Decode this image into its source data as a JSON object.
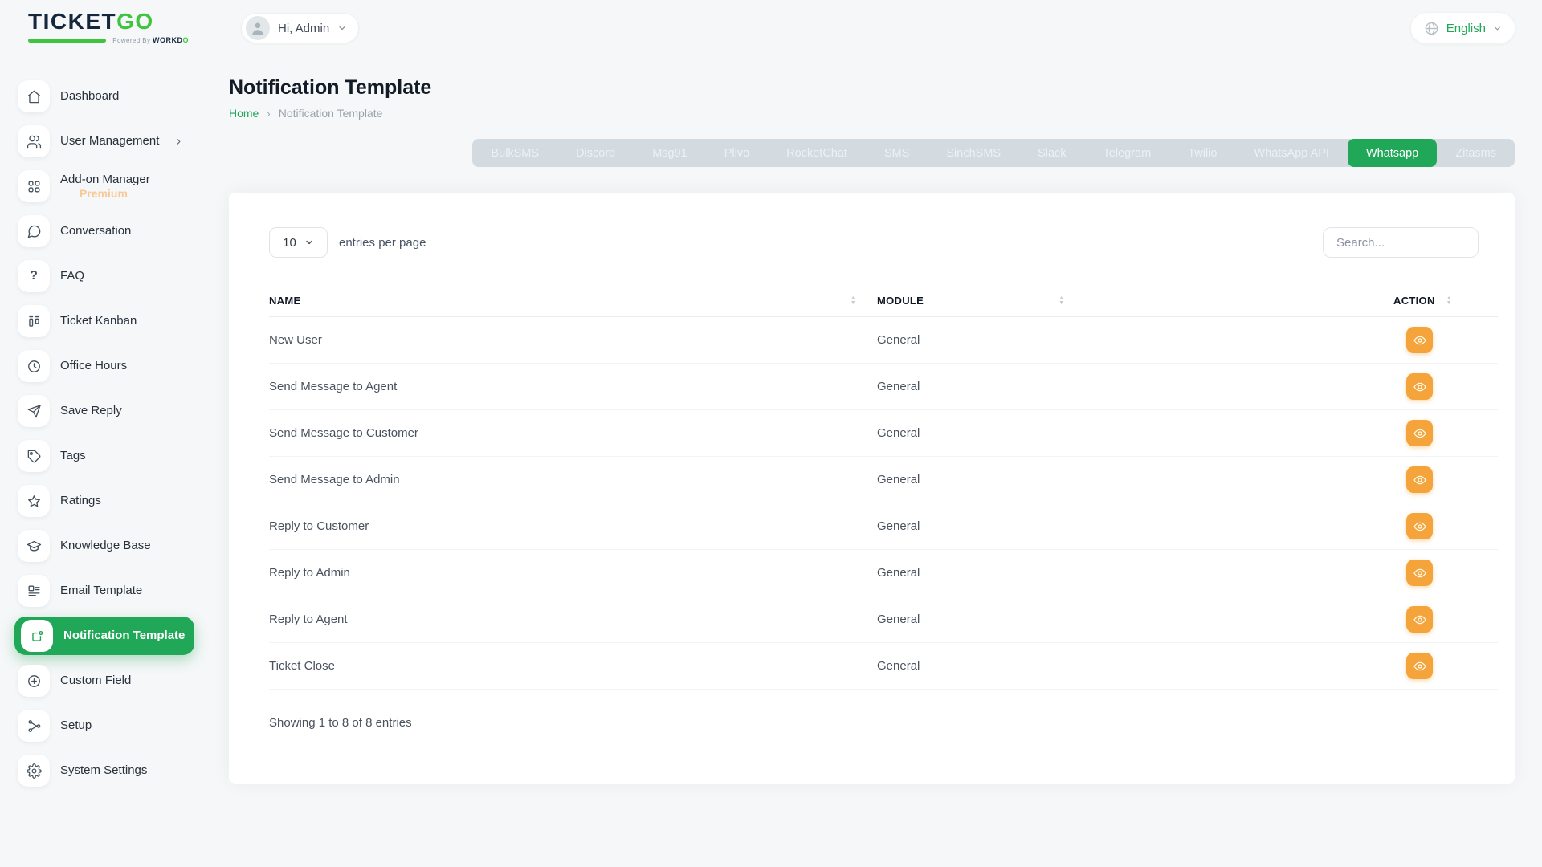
{
  "brand": {
    "name_primary": "TICKET",
    "name_accent": "GO",
    "powered_prefix": "Powered By",
    "powered_brand_main": "WORKD",
    "powered_brand_accent": "O"
  },
  "header": {
    "greeting": "Hi, Admin",
    "language": "English"
  },
  "sidebar": {
    "items": [
      {
        "label": "Dashboard"
      },
      {
        "label": "User Management"
      },
      {
        "label": "Add-on Manager",
        "badge": "Premium"
      },
      {
        "label": "Conversation"
      },
      {
        "label": "FAQ"
      },
      {
        "label": "Ticket Kanban"
      },
      {
        "label": "Office Hours"
      },
      {
        "label": "Save Reply"
      },
      {
        "label": "Tags"
      },
      {
        "label": "Ratings"
      },
      {
        "label": "Knowledge Base"
      },
      {
        "label": "Email Template"
      },
      {
        "label": "Notification Template"
      },
      {
        "label": "Custom Field"
      },
      {
        "label": "Setup"
      },
      {
        "label": "System Settings"
      }
    ]
  },
  "page": {
    "title": "Notification Template",
    "breadcrumb": {
      "home": "Home",
      "current": "Notification Template"
    }
  },
  "tabs": {
    "active": "Whatsapp",
    "items": [
      {
        "label": "BulkSMS"
      },
      {
        "label": "Discord"
      },
      {
        "label": "Msg91"
      },
      {
        "label": "Plivo"
      },
      {
        "label": "RocketChat"
      },
      {
        "label": "SMS"
      },
      {
        "label": "SinchSMS"
      },
      {
        "label": "Slack"
      },
      {
        "label": "Telegram"
      },
      {
        "label": "Twilio"
      },
      {
        "label": "WhatsApp API"
      },
      {
        "label": "Whatsapp"
      },
      {
        "label": "Zitasms"
      }
    ]
  },
  "table": {
    "entries_per_page": "10",
    "entries_label": "entries per page",
    "search_placeholder": "Search...",
    "columns": [
      {
        "label": "NAME"
      },
      {
        "label": "MODULE"
      },
      {
        "label": "ACTION"
      }
    ],
    "rows": [
      {
        "name": "New User",
        "module": "General"
      },
      {
        "name": "Send Message to Agent",
        "module": "General"
      },
      {
        "name": "Send Message to Customer",
        "module": "General"
      },
      {
        "name": "Send Message to Admin",
        "module": "General"
      },
      {
        "name": "Reply to Customer",
        "module": "General"
      },
      {
        "name": "Reply to Admin",
        "module": "General"
      },
      {
        "name": "Reply to Agent",
        "module": "General"
      },
      {
        "name": "Ticket Close",
        "module": "General"
      }
    ],
    "footer": "Showing 1 to 8 of 8 entries"
  },
  "colors": {
    "primary_green": "#20a757",
    "logo_green": "#3fc43f",
    "logo_navy": "#15273d",
    "action_orange": "#f5a43b",
    "premium_orange": "#f9b975",
    "tabs_bg": "#d3dbe0",
    "tab_text": "#edf1f3"
  }
}
